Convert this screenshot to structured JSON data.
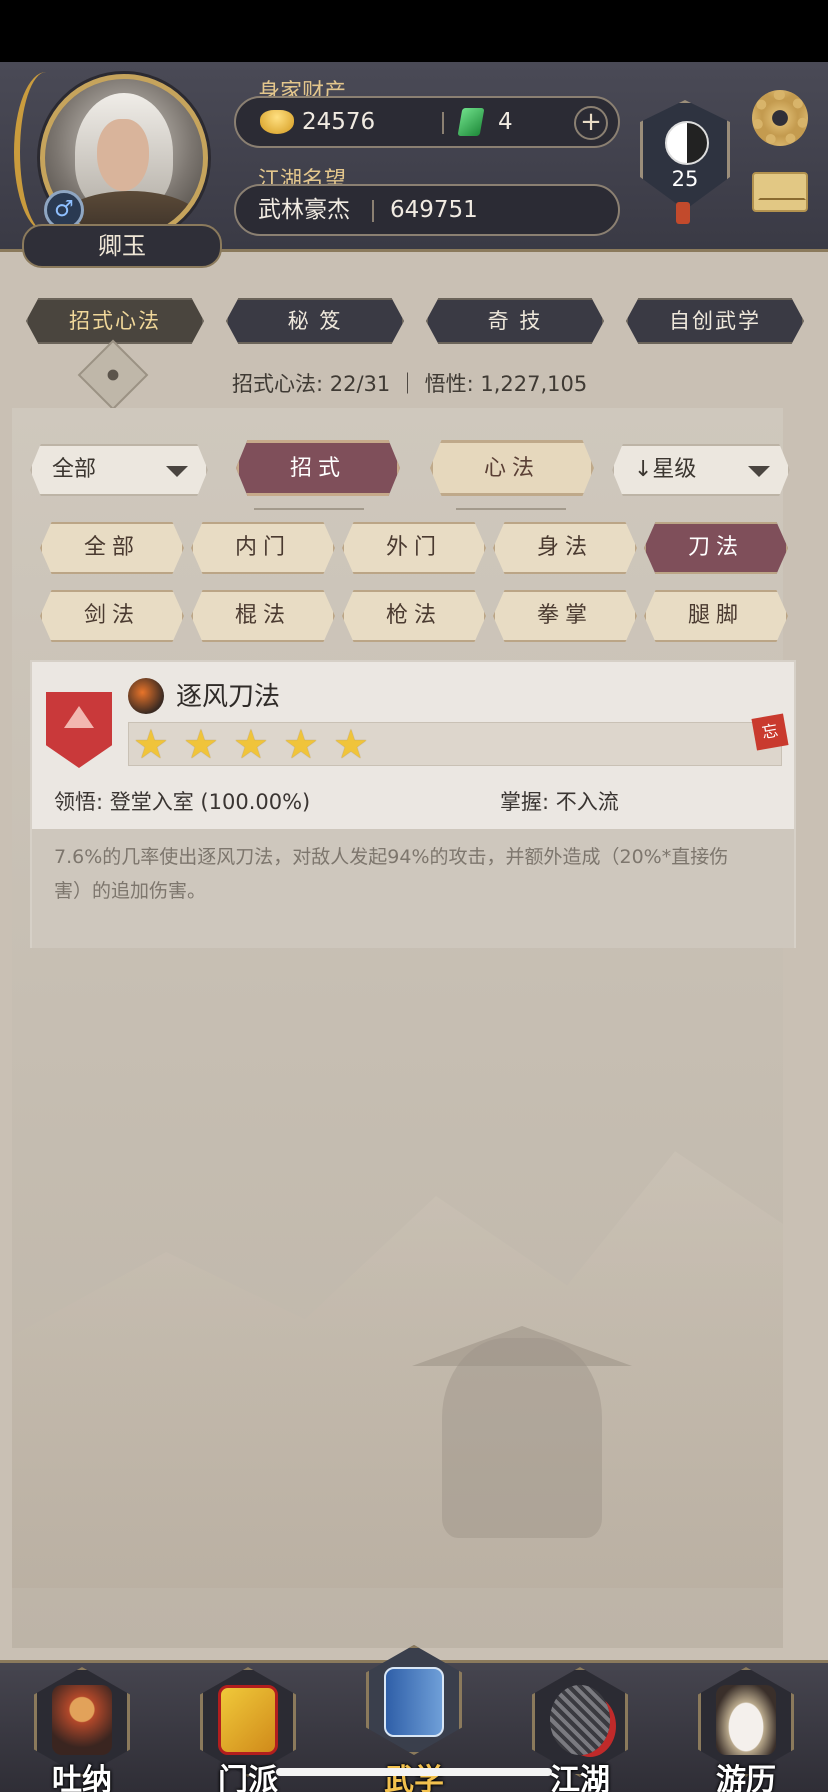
{
  "header": {
    "player_name": "卿玉",
    "gender_symbol": "♂",
    "wealth_label": "身家财产",
    "gold": "24576",
    "jade": "4",
    "plus_symbol": "+",
    "fame_label": "江湖名望",
    "fame_title": "武林豪杰",
    "fame_value": "649751",
    "level": "25"
  },
  "top_tabs": [
    {
      "label": "招式心法",
      "active": true
    },
    {
      "label": "秘 笈",
      "active": false
    },
    {
      "label": "奇 技",
      "active": false
    },
    {
      "label": "自创武学",
      "active": false
    }
  ],
  "stats_line": "招式心法: 22/31 ｜ 悟性: 1,227,105",
  "filters": {
    "left_dropdown": "全部",
    "toggle_skill": "招式",
    "toggle_mind": "心法",
    "sort_dropdown": "↓星级"
  },
  "categories": [
    {
      "label": "全部",
      "active": false
    },
    {
      "label": "内门",
      "active": false
    },
    {
      "label": "外门",
      "active": false
    },
    {
      "label": "身法",
      "active": false
    },
    {
      "label": "刀法",
      "active": true
    },
    {
      "label": "剑法",
      "active": false
    },
    {
      "label": "棍法",
      "active": false
    },
    {
      "label": "枪法",
      "active": false
    },
    {
      "label": "拳掌",
      "active": false
    },
    {
      "label": "腿脚",
      "active": false
    }
  ],
  "skill_card": {
    "name": "逐风刀法",
    "stars": 5,
    "forget_tag": "忘",
    "comprehension": "领悟: 登堂入室 (100.00%)",
    "mastery": "掌握: 不入流",
    "description": "7.6%的几率使出逐风刀法，对敌人发起94%的攻击，并额外造成（20%*直接伤害）的追加伤害。"
  },
  "bottom_nav": [
    {
      "label": "吐纳",
      "active": false
    },
    {
      "label": "门派",
      "active": false
    },
    {
      "label": "武学",
      "active": true
    },
    {
      "label": "江湖",
      "active": false
    },
    {
      "label": "游历",
      "active": false
    }
  ],
  "colors": {
    "accent_active": "#7f4f5a",
    "gold_text": "#e3c68c",
    "star": "#f0c43a"
  }
}
